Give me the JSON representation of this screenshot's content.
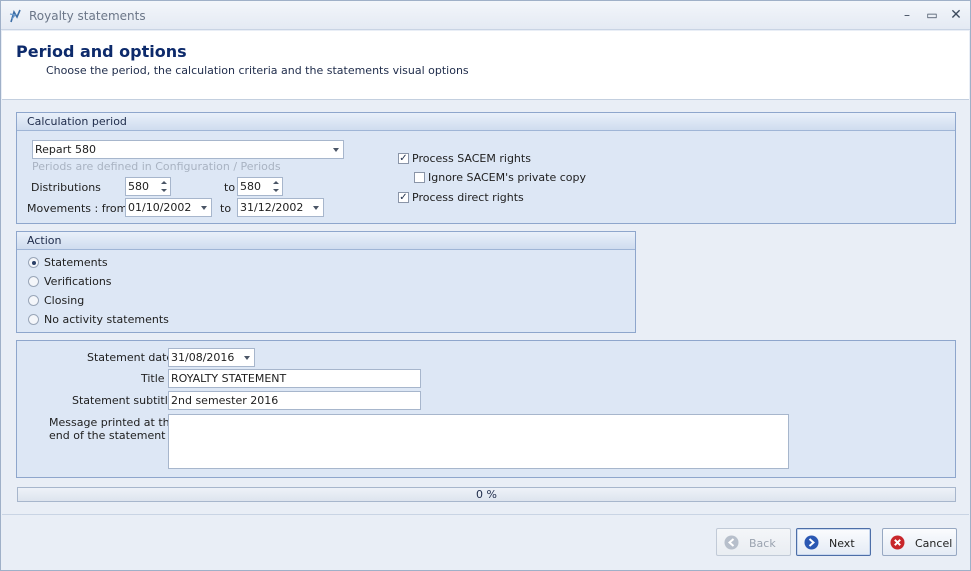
{
  "window": {
    "title": "Royalty statements",
    "controls": {
      "minimize": "–",
      "maximize": "▭",
      "close": "✕"
    }
  },
  "header": {
    "title": "Period and options",
    "subtitle": "Choose the period, the calculation criteria and the statements visual options"
  },
  "calculation_period": {
    "group_title": "Calculation period",
    "repart_value": "Repart 580",
    "periods_hint": "Periods are defined in Configuration / Periods",
    "distributions_label": "Distributions",
    "distributions_from": "580",
    "distributions_to_label": "to",
    "distributions_to": "580",
    "movements_label": "Movements : from",
    "movements_from": "01/10/2002",
    "movements_to_label": "to",
    "movements_to": "31/12/2002",
    "process_sacem_label": "Process SACEM rights",
    "process_sacem_checked": true,
    "ignore_private_copy_label": "Ignore SACEM's private copy",
    "ignore_private_copy_checked": false,
    "process_direct_label": "Process direct rights",
    "process_direct_checked": true
  },
  "action": {
    "group_title": "Action",
    "options": [
      "Statements",
      "Verifications",
      "Closing",
      "No activity statements"
    ],
    "selected": "Statements"
  },
  "statement": {
    "date_label": "Statement date",
    "date_value": "31/08/2016",
    "title_label": "Title",
    "title_value": "ROYALTY STATEMENT",
    "subtitle_label": "Statement subtitle",
    "subtitle_value": "2nd semester 2016",
    "message_label_line1": "Message printed at the",
    "message_label_line2": "end of the statement",
    "message_value": ""
  },
  "progress": {
    "percent": 0,
    "text": "0 %"
  },
  "buttons": {
    "back": "Back",
    "next": "Next",
    "cancel": "Cancel"
  },
  "colors": {
    "header_title": "#0d2a6b",
    "next_icon": "#2b58b3",
    "cancel_icon": "#c8262b",
    "back_icon_disabled": "#b7bfcb"
  }
}
